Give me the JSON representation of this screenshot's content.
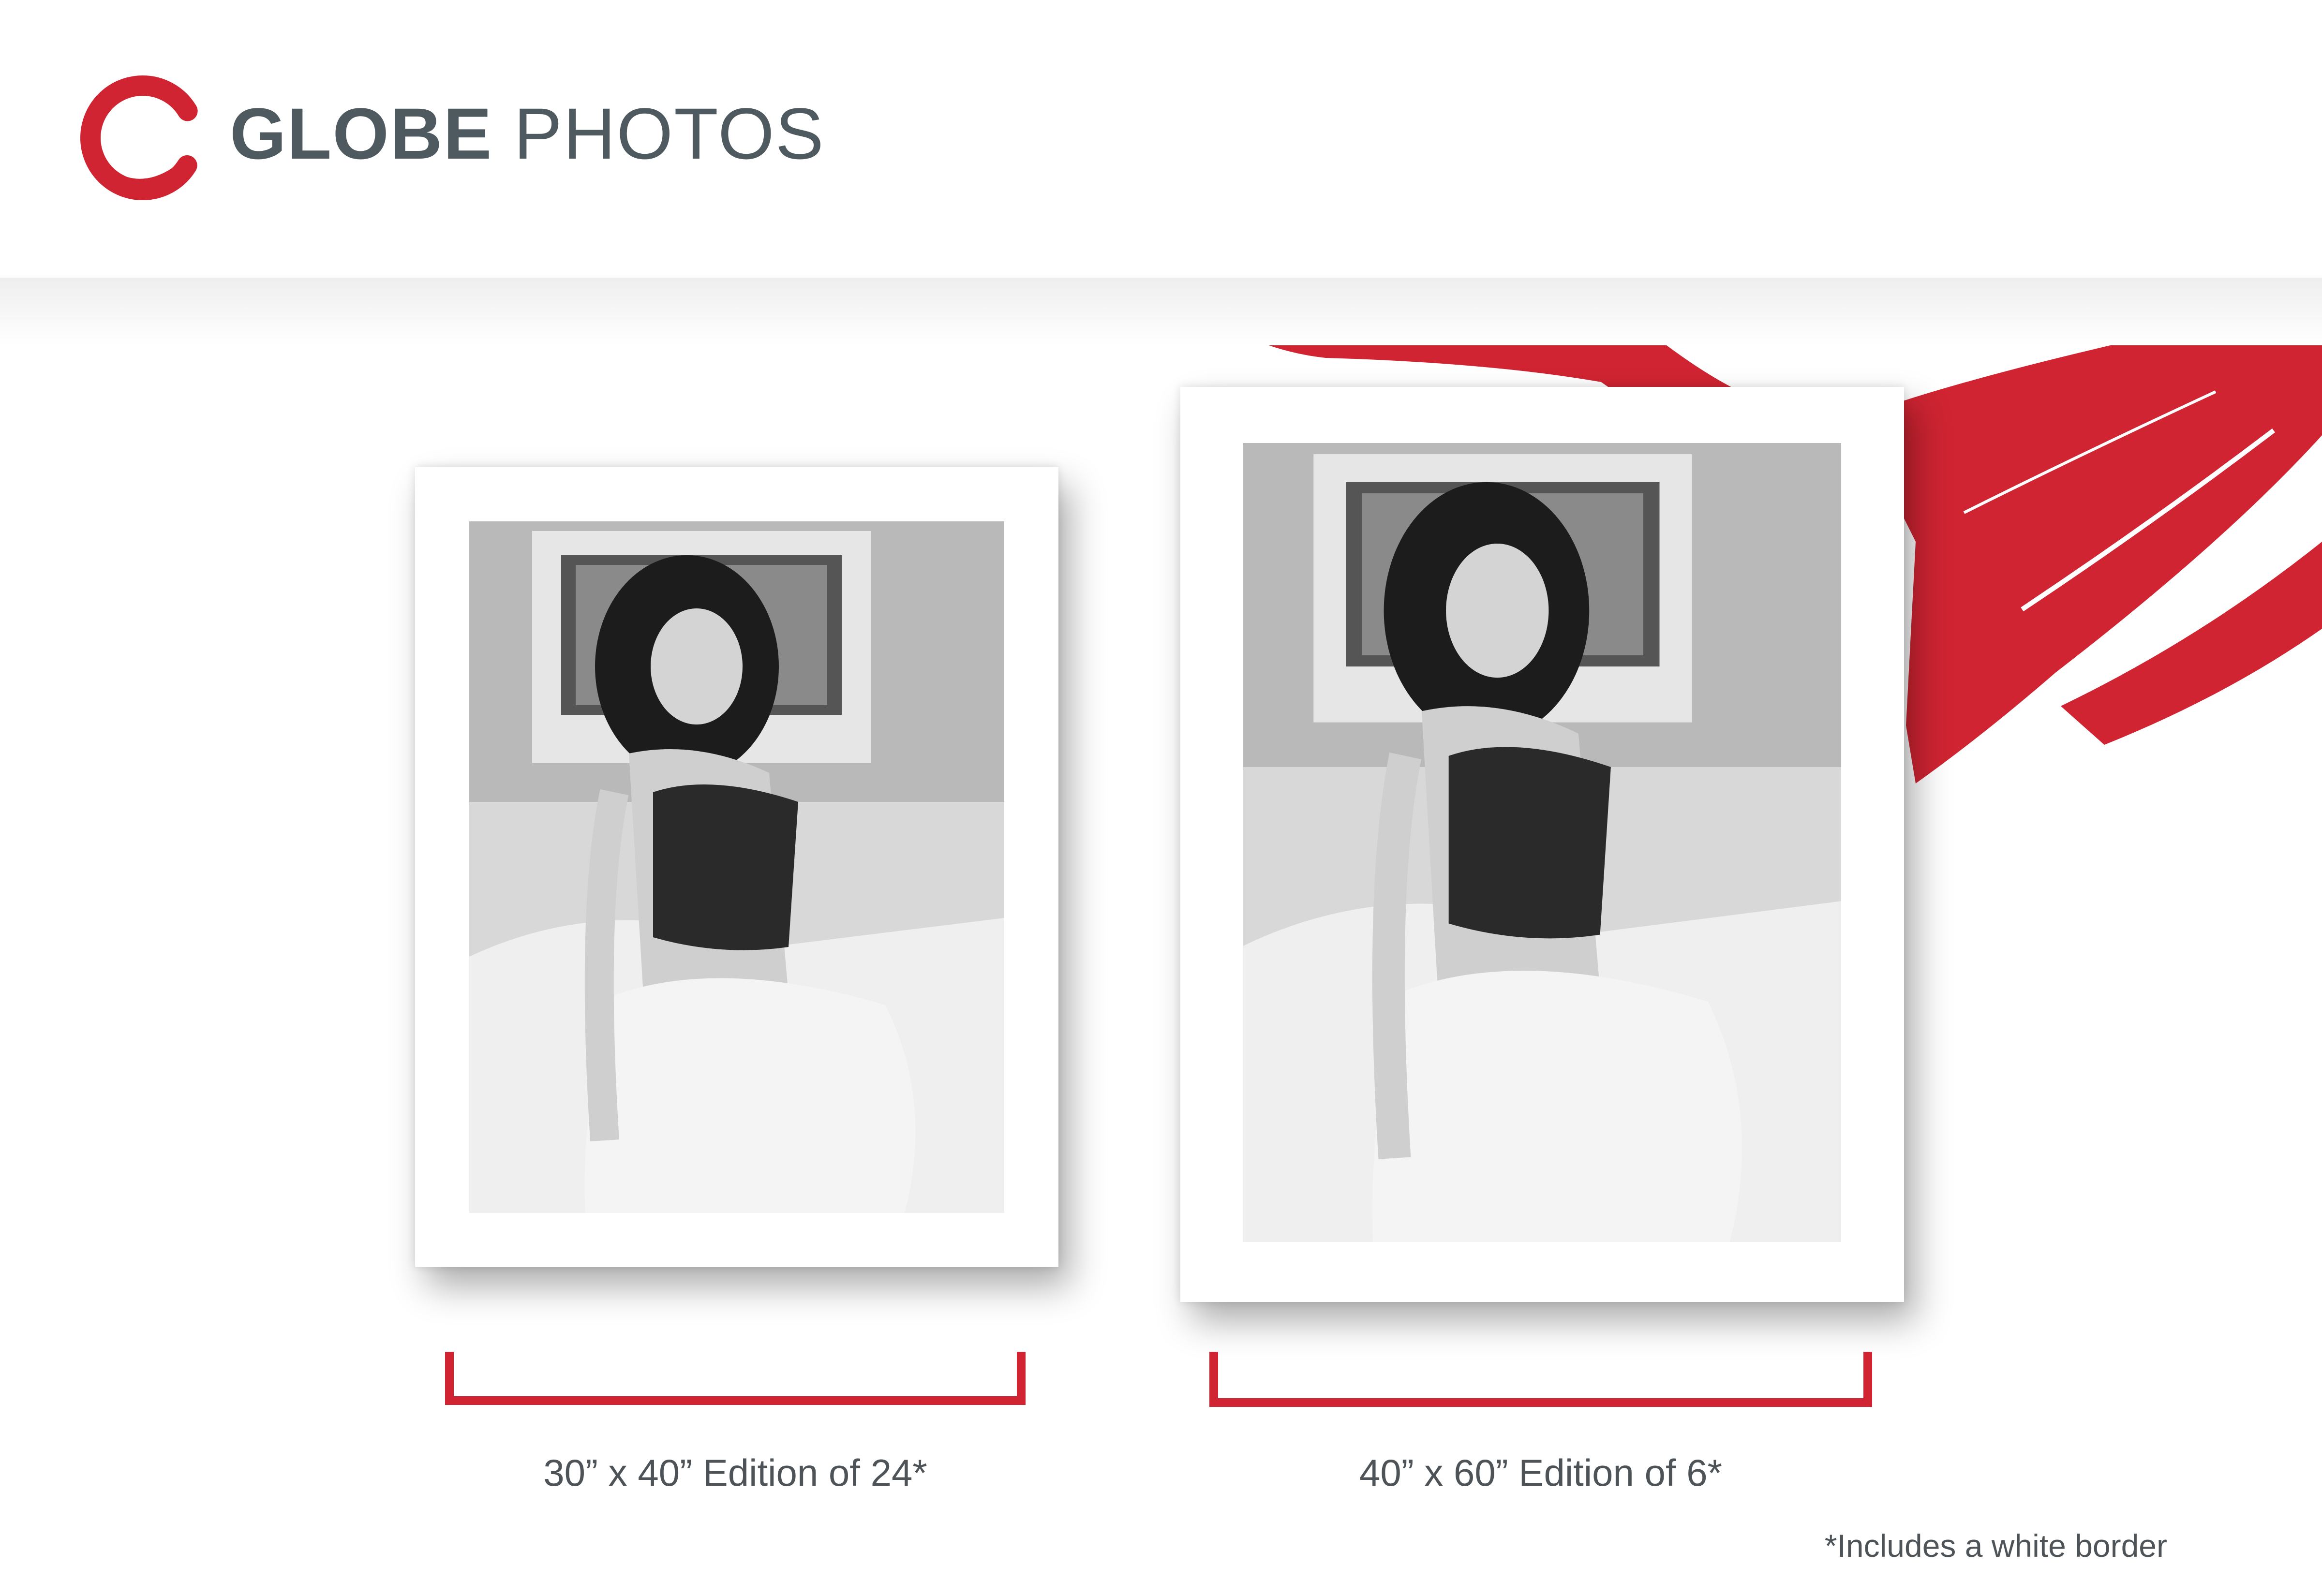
{
  "header": {
    "brand_bold": "GLOBE",
    "brand_light": "PHOTOS",
    "logo_icon": "globe-photos-logo-mark",
    "brand_color": "#d02432",
    "text_color": "#4f5a60"
  },
  "prints": [
    {
      "size_label": "30” x 40” Edition of 24*"
    },
    {
      "size_label": "40” x 60” Edition of 6*"
    }
  ],
  "footnote": "*Includes a white border",
  "colors": {
    "accent": "#d02432",
    "caption": "#4d5357"
  }
}
